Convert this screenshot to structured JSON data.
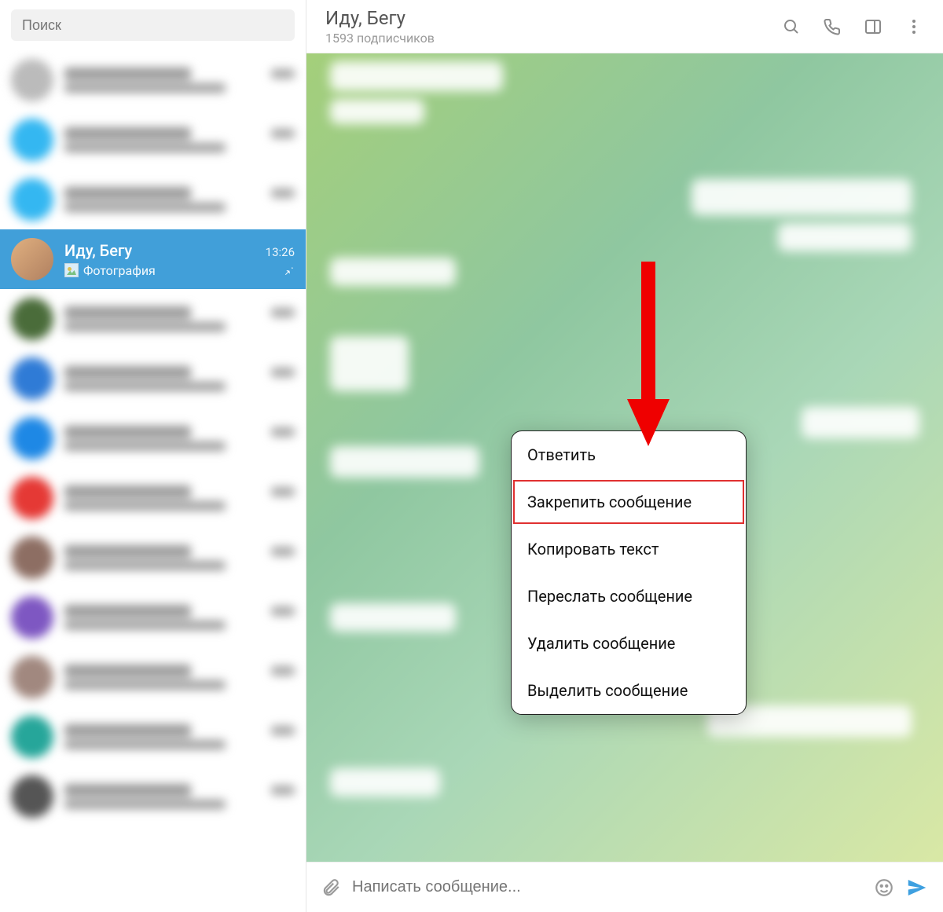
{
  "search": {
    "placeholder": "Поиск"
  },
  "activeChat": {
    "name": "Иду, Бегу",
    "time": "13:26",
    "subtitle": "Фотография"
  },
  "header": {
    "title": "Иду, Бегу",
    "subtitle": "1593 подписчиков"
  },
  "composer": {
    "placeholder": "Написать сообщение..."
  },
  "contextMenu": {
    "items": [
      "Ответить",
      "Закрепить сообщение",
      "Копировать текст",
      "Переслать сообщение",
      "Удалить сообщение",
      "Выделить сообщение"
    ],
    "highlightedIndex": 1
  }
}
